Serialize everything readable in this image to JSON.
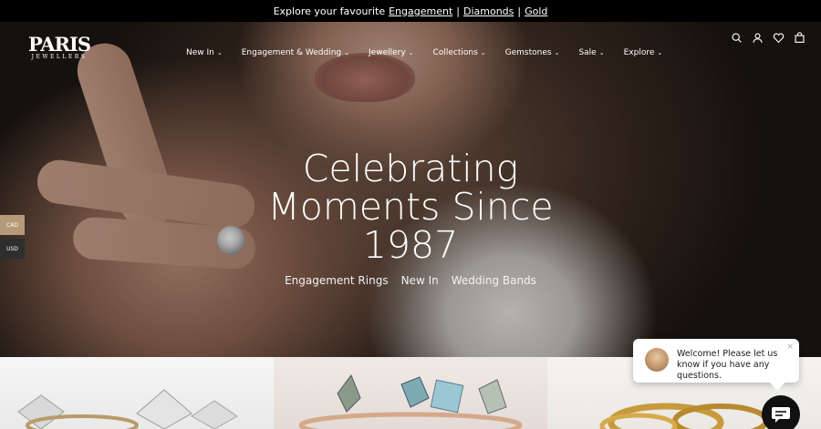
{
  "announcement": {
    "prefix": "Explore your favourite",
    "links": [
      "Engagement",
      "Diamonds",
      "Gold"
    ],
    "separator": "|"
  },
  "logo": {
    "line1": "PARIS",
    "line2": "JEWELLERS"
  },
  "nav": {
    "items": [
      {
        "label": "New In"
      },
      {
        "label": "Engagement & Wedding"
      },
      {
        "label": "Jewellery"
      },
      {
        "label": "Collections"
      },
      {
        "label": "Gemstones"
      },
      {
        "label": "Sale"
      },
      {
        "label": "Explore"
      }
    ],
    "chevron": "⌄"
  },
  "header_icons": [
    "search-icon",
    "account-icon",
    "wishlist-icon",
    "cart-icon"
  ],
  "hero": {
    "title_lines": [
      "Celebrating",
      "Moments Since",
      "1987"
    ],
    "links": [
      "Engagement Rings",
      "New In",
      "Wedding Bands"
    ]
  },
  "currency": {
    "cad": "CAD",
    "usd": "USD"
  },
  "chat": {
    "message": "Welcome! Please let us know if you have any questions.",
    "close": "×"
  },
  "colors": {
    "accent": "#b49a79",
    "dark": "#000000"
  }
}
